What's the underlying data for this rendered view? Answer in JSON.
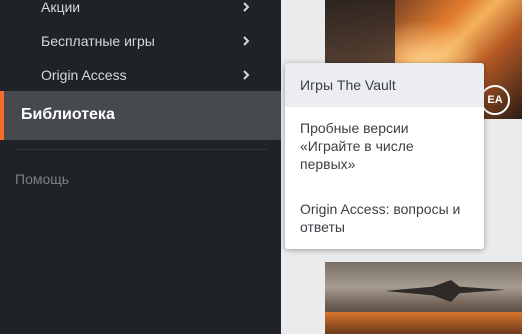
{
  "sidebar": {
    "items": [
      {
        "label": "Акции"
      },
      {
        "label": "Бесплатные игры"
      },
      {
        "label": "Origin Access"
      }
    ],
    "active": {
      "label": "Библиотека"
    },
    "help": {
      "label": "Помощь"
    }
  },
  "popup": {
    "items": [
      {
        "label": "Игры The Vault"
      },
      {
        "label": "Пробные версии «Играйте в числе первых»"
      },
      {
        "label": "Origin Access: вопросы и ответы"
      }
    ]
  },
  "covers": {
    "top_badge": "EA"
  },
  "colors": {
    "accent": "#f56c2d",
    "sidebar_bg": "#1f2226",
    "active_bg": "#464a4f"
  }
}
